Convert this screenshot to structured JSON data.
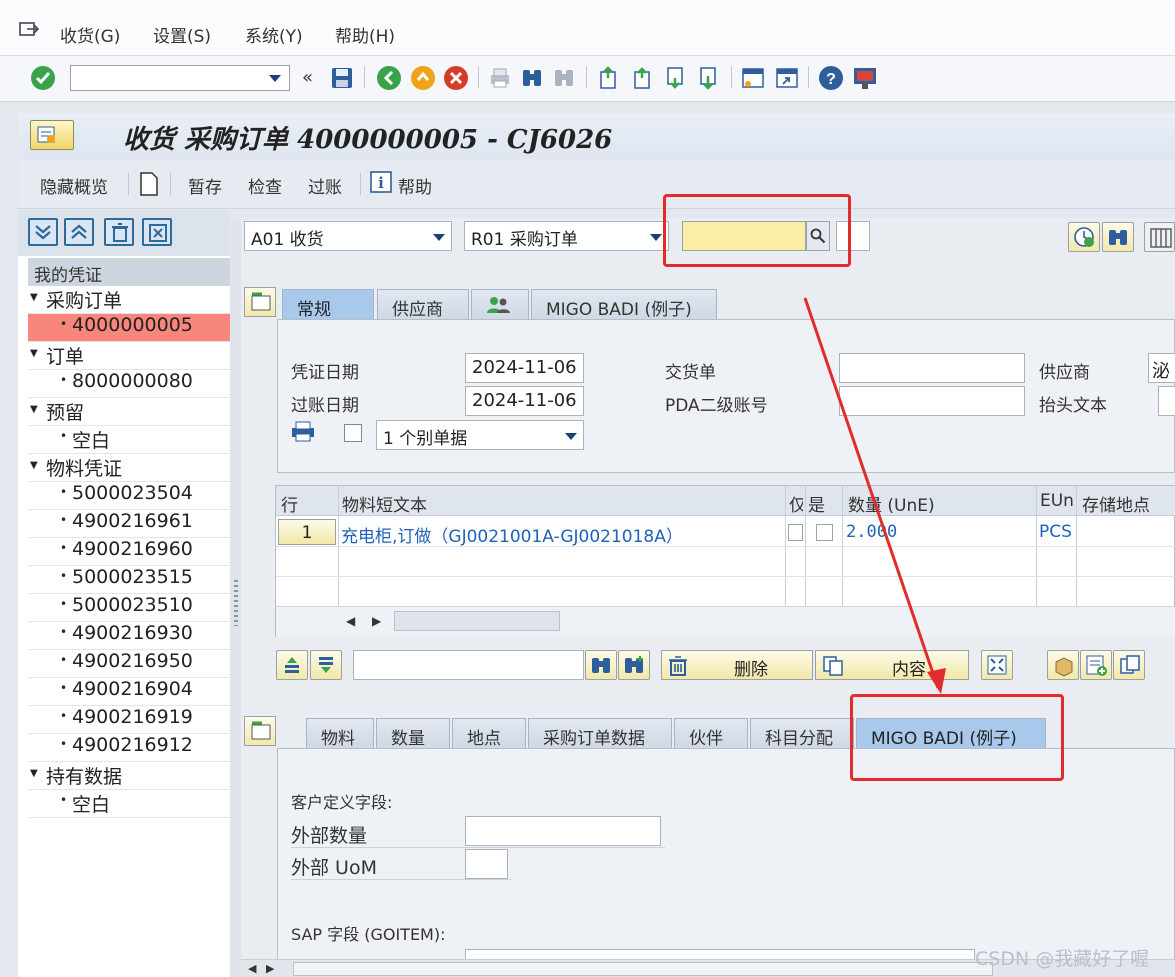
{
  "menu": [
    {
      "label": "收货(G)"
    },
    {
      "label": "设置(S)"
    },
    {
      "label": "系统(Y)"
    },
    {
      "label": "帮助(H)"
    }
  ],
  "window": {
    "title": "收货 采购订单 4000000005 - CJ6026"
  },
  "app_toolbar": {
    "hide_overview": "隐藏概览",
    "hold": "暂存",
    "check": "检查",
    "post": "过账",
    "help": "帮助"
  },
  "left": {
    "tree_title": "我的凭证",
    "nodes": [
      {
        "text": "采购订单",
        "type": "folder"
      },
      {
        "text": "4000000005",
        "type": "leaf",
        "selected": true
      },
      {
        "text": "订单",
        "type": "folder"
      },
      {
        "text": "8000000080",
        "type": "leaf"
      },
      {
        "text": "预留",
        "type": "folder"
      },
      {
        "text": "空白",
        "type": "leaf"
      },
      {
        "text": "物料凭证",
        "type": "folder"
      },
      {
        "text": "5000023504",
        "type": "leaf"
      },
      {
        "text": "4900216961",
        "type": "leaf"
      },
      {
        "text": "4900216960",
        "type": "leaf"
      },
      {
        "text": "5000023515",
        "type": "leaf"
      },
      {
        "text": "5000023510",
        "type": "leaf"
      },
      {
        "text": "4900216930",
        "type": "leaf"
      },
      {
        "text": "4900216950",
        "type": "leaf"
      },
      {
        "text": "4900216904",
        "type": "leaf"
      },
      {
        "text": "4900216919",
        "type": "leaf"
      },
      {
        "text": "4900216912",
        "type": "leaf"
      },
      {
        "text": "持有数据",
        "type": "folder"
      },
      {
        "text": "空白",
        "type": "leaf"
      }
    ]
  },
  "selection": {
    "action": "A01 收货",
    "reference": "R01 采购订单",
    "doc_number": ""
  },
  "header_tabs": [
    {
      "label": "常规",
      "active": true
    },
    {
      "label": "供应商"
    },
    {
      "label": ""
    },
    {
      "label": "MIGO BADI (例子)"
    }
  ],
  "header": {
    "doc_date_label": "凭证日期",
    "doc_date": "2024-11-06",
    "post_date_label": "过账日期",
    "post_date": "2024-11-06",
    "delivery_note_label": "交货单",
    "pda_label": "PDA二级账号",
    "vendor_label": "供应商",
    "vendor_value": "泌",
    "header_text_label": "抬头文本",
    "print_option": "1 个别单据"
  },
  "items": {
    "columns": [
      "行",
      "物料短文本",
      "仅",
      "是",
      "数量 (UnE)",
      "EUn",
      "存储地点"
    ],
    "rows": [
      {
        "line": "1",
        "text": "充电柜,订做（GJ0021001A-GJ0021018A）",
        "qty": "2.000",
        "unit": "PCS"
      }
    ]
  },
  "item_toolbar": {
    "delete": "删除",
    "contents": "内容"
  },
  "detail_tabs": [
    {
      "label": "物料"
    },
    {
      "label": "数量"
    },
    {
      "label": "地点"
    },
    {
      "label": "采购订单数据"
    },
    {
      "label": "伙伴"
    },
    {
      "label": "科目分配"
    },
    {
      "label": "MIGO BADI (例子)",
      "active": true
    }
  ],
  "detail": {
    "section_customer": "客户定义字段:",
    "ext_qty_label": "外部数量",
    "ext_qty": "",
    "ext_uom_label": "外部 UoM",
    "ext_uom": "",
    "section_sap": "SAP 字段 (GOITEM):"
  },
  "watermark": "CSDN @我藏好了喔",
  "colors": {
    "selected_tree": "#f8867c",
    "highlight_box": "#e42b2b",
    "active_tab": "#a8c8ec",
    "required_field": "#fbeda3"
  }
}
